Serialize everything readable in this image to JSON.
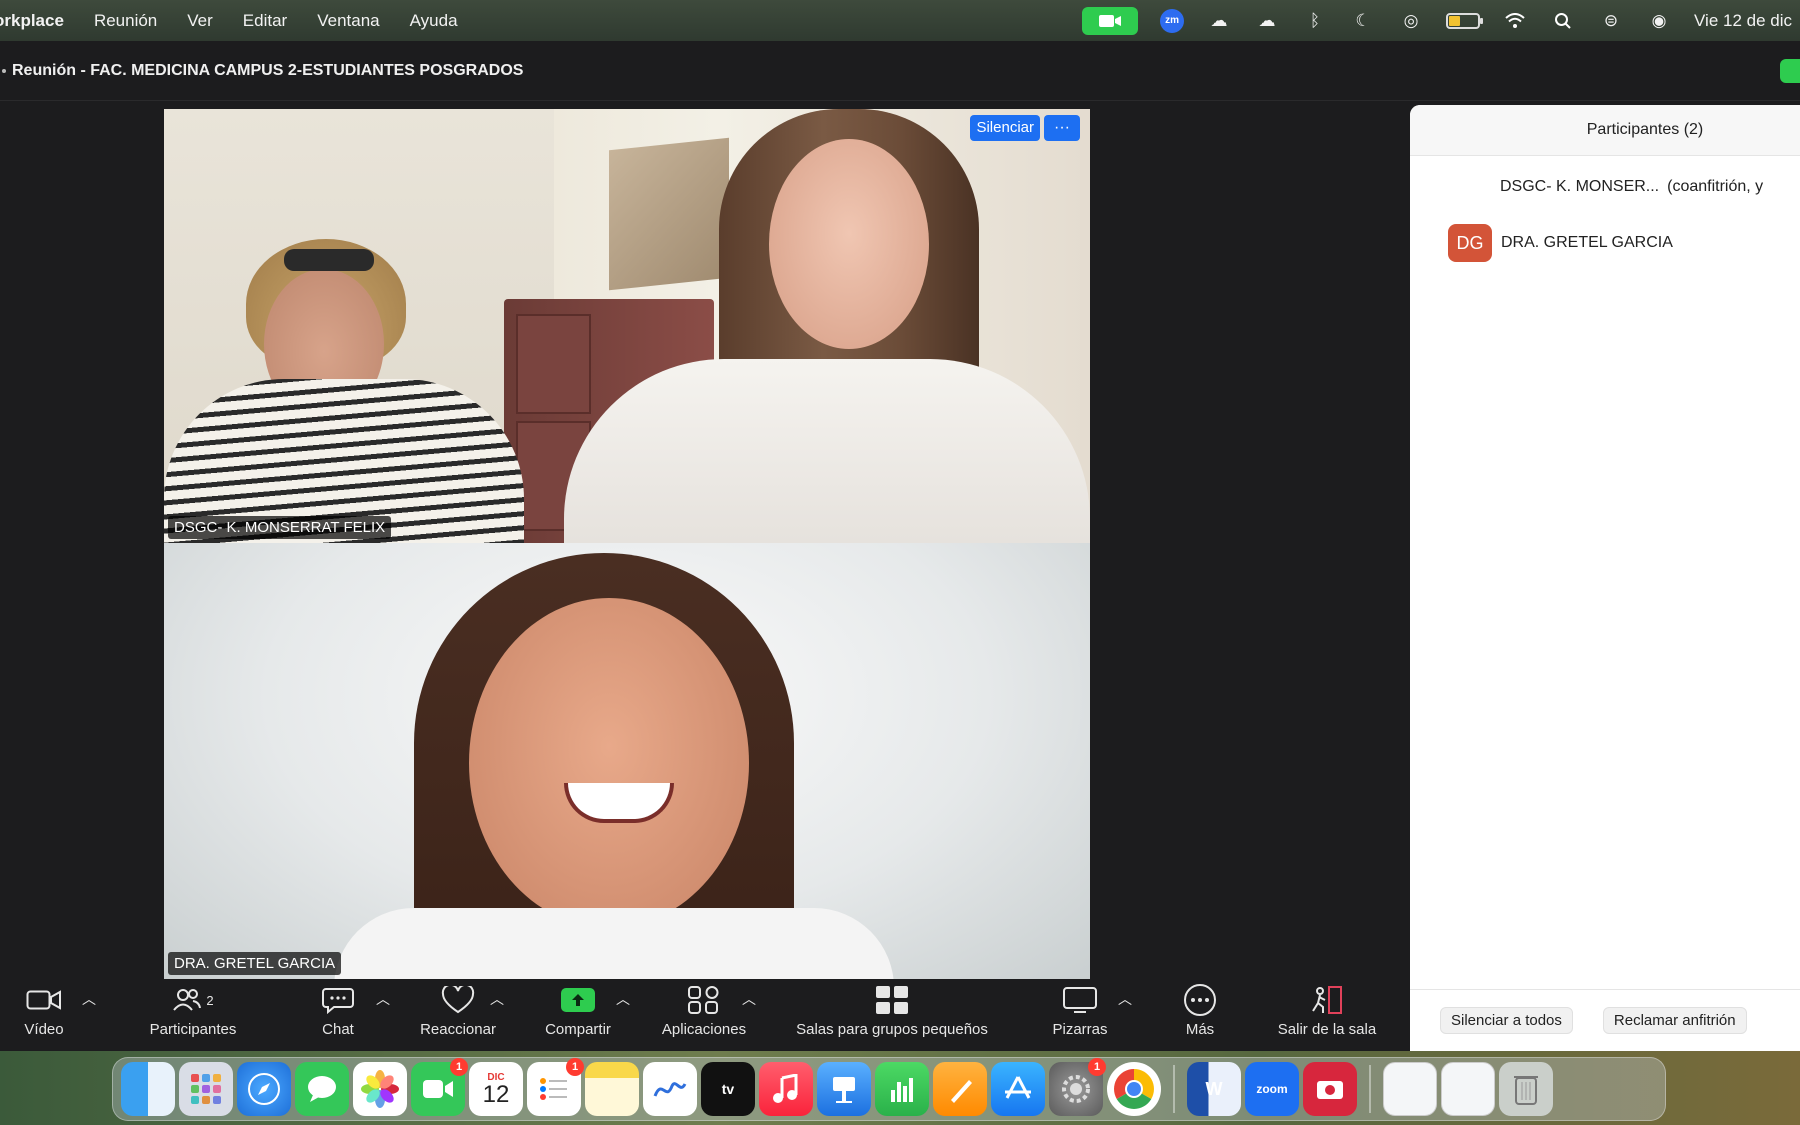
{
  "menubar": {
    "app_name": "orkplace",
    "items": [
      "Reunión",
      "Ver",
      "Editar",
      "Ventana",
      "Ayuda"
    ],
    "zm_label": "zm",
    "clock": "Vie 12 de dic",
    "battery_level": 0.35
  },
  "window": {
    "title": "Reunión - FAC. MEDICINA CAMPUS 2-ESTUDIANTES POSGRADOS"
  },
  "gallery": {
    "tiles": [
      {
        "name": "DSGC- K. MONSERRAT FELIX",
        "mute_button": "Silenciar",
        "more": "···"
      },
      {
        "name": "DRA. GRETEL GARCIA"
      }
    ]
  },
  "participants_panel": {
    "title": "Participantes (2)",
    "participants": [
      {
        "name": "DSGC- K. MONSER...",
        "role": "(coanfitrión, y"
      },
      {
        "initials": "DG",
        "name": "DRA. GRETEL GARCIA"
      }
    ],
    "mute_all": "Silenciar a todos",
    "claim_host": "Reclamar anfitrión"
  },
  "toolbar": {
    "video": "Vídeo",
    "participants": "Participantes",
    "participants_count": "2",
    "chat": "Chat",
    "react": "Reaccionar",
    "share": "Compartir",
    "apps": "Aplicaciones",
    "breakout": "Salas para grupos pequeños",
    "whiteboards": "Pizarras",
    "more": "Más",
    "leave": "Salir de la sala"
  },
  "dock": {
    "calendar_month": "DIC",
    "calendar_day": "12",
    "tv_label": "tv",
    "zoom_label": "zoom",
    "facetime_badge": "1",
    "reminders_badge": "1",
    "settings_badge": "1"
  },
  "colors": {
    "accent_blue": "#1d6ff2",
    "share_green": "#2ecc4f",
    "avatar_orange": "#d35438",
    "window_bg": "#1c1c1e"
  }
}
